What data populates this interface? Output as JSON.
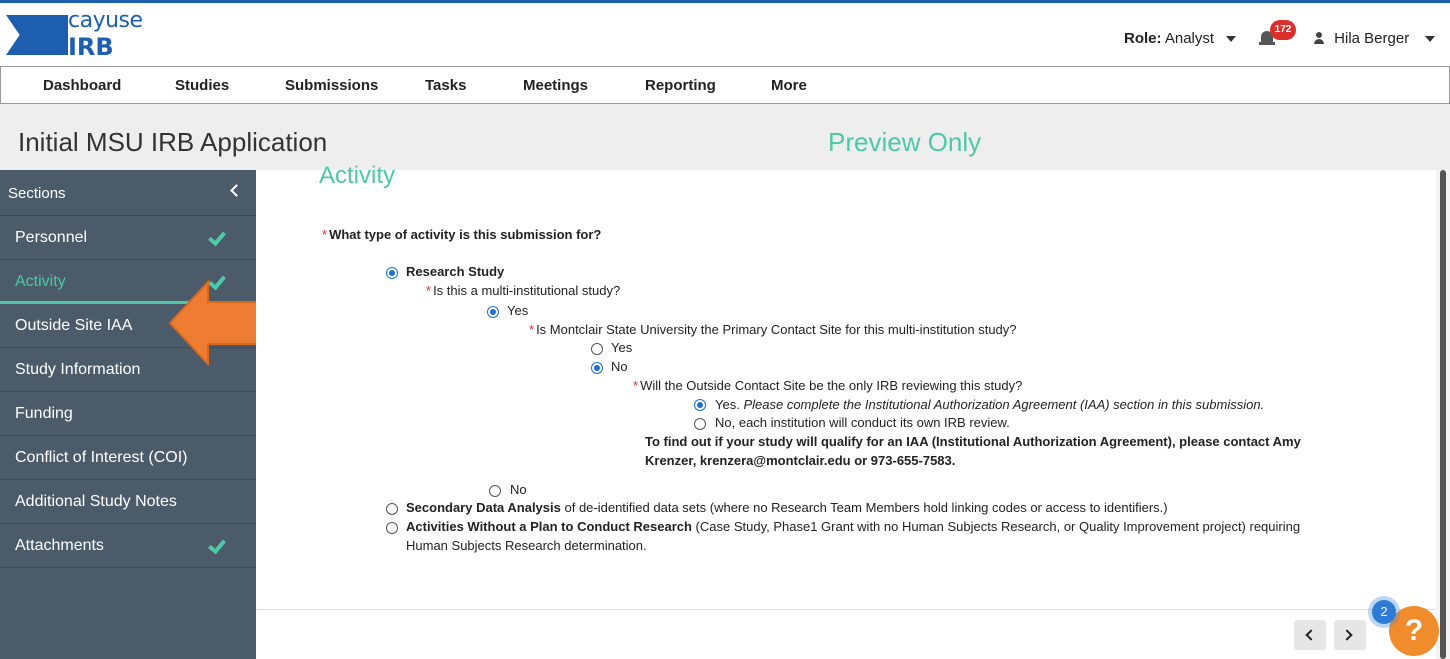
{
  "header": {
    "logo_top": "cayuse",
    "logo_bottom": "IRB",
    "role_label": "Role:",
    "role_value": "Analyst",
    "notification_count": "172",
    "user_name": "Hila Berger"
  },
  "nav": {
    "items": [
      "Dashboard",
      "Studies",
      "Submissions",
      "Tasks",
      "Meetings",
      "Reporting",
      "More"
    ]
  },
  "titlebar": {
    "title": "Initial MSU IRB Application",
    "mode": "Preview Only"
  },
  "sidebar": {
    "heading": "Sections",
    "items": [
      {
        "label": "Personnel",
        "complete": true,
        "active": false
      },
      {
        "label": "Activity",
        "complete": true,
        "active": true
      },
      {
        "label": "Outside Site IAA",
        "complete": false,
        "active": false
      },
      {
        "label": "Study Information",
        "complete": false,
        "active": false
      },
      {
        "label": "Funding",
        "complete": false,
        "active": false
      },
      {
        "label": "Conflict of Interest (COI)",
        "complete": false,
        "active": false
      },
      {
        "label": "Additional Study Notes",
        "complete": false,
        "active": false
      },
      {
        "label": "Attachments",
        "complete": true,
        "active": false
      }
    ]
  },
  "main": {
    "section_heading": "Activity",
    "q1": "What type of activity is this submission for?",
    "opt_research": "Research Study",
    "q2": "Is this a multi-institutional study?",
    "q2_yes": "Yes",
    "q3": "Is Montclair State University the Primary Contact Site for this multi-institution study?",
    "q3_yes": "Yes",
    "q3_no": "No",
    "q4": "Will the Outside Contact Site be the only IRB reviewing this study?",
    "q4_yes_label": "Yes.",
    "q4_yes_note": "Please complete the Institutional Authorization Agreement  (IAA) section in this submission.",
    "q4_no": "No, each institution will conduct its own IRB review.",
    "iaa_info_line1": "To find out if your study will qualify for an IAA (Institutional Authorization Agreement), please contact Amy",
    "iaa_info_line2": "Krenzer, krenzera@montclair.edu or 973-655-7583.",
    "q2_no": "No",
    "opt_secondary_bold": "Secondary Data Analysis",
    "opt_secondary_rest": " of de-identified data sets (where no Research Team Members hold linking codes or access to identifiers.)",
    "opt_activities_bold": "Activities Without a Plan to Conduct Research",
    "opt_activities_rest": " (Case Study, Phase1 Grant with no Human Subjects Research, or Quality Improvement project) requiring",
    "opt_activities_line2": "Human Subjects Research determination."
  },
  "help": {
    "count": "2",
    "symbol": "?"
  },
  "colors": {
    "brand_blue": "#1d5fae",
    "accent_green": "#4cc9a6",
    "sidebar_bg": "#4b5b6a",
    "arrow_orange": "#ee7d33",
    "help_orange": "#f08c2b"
  }
}
